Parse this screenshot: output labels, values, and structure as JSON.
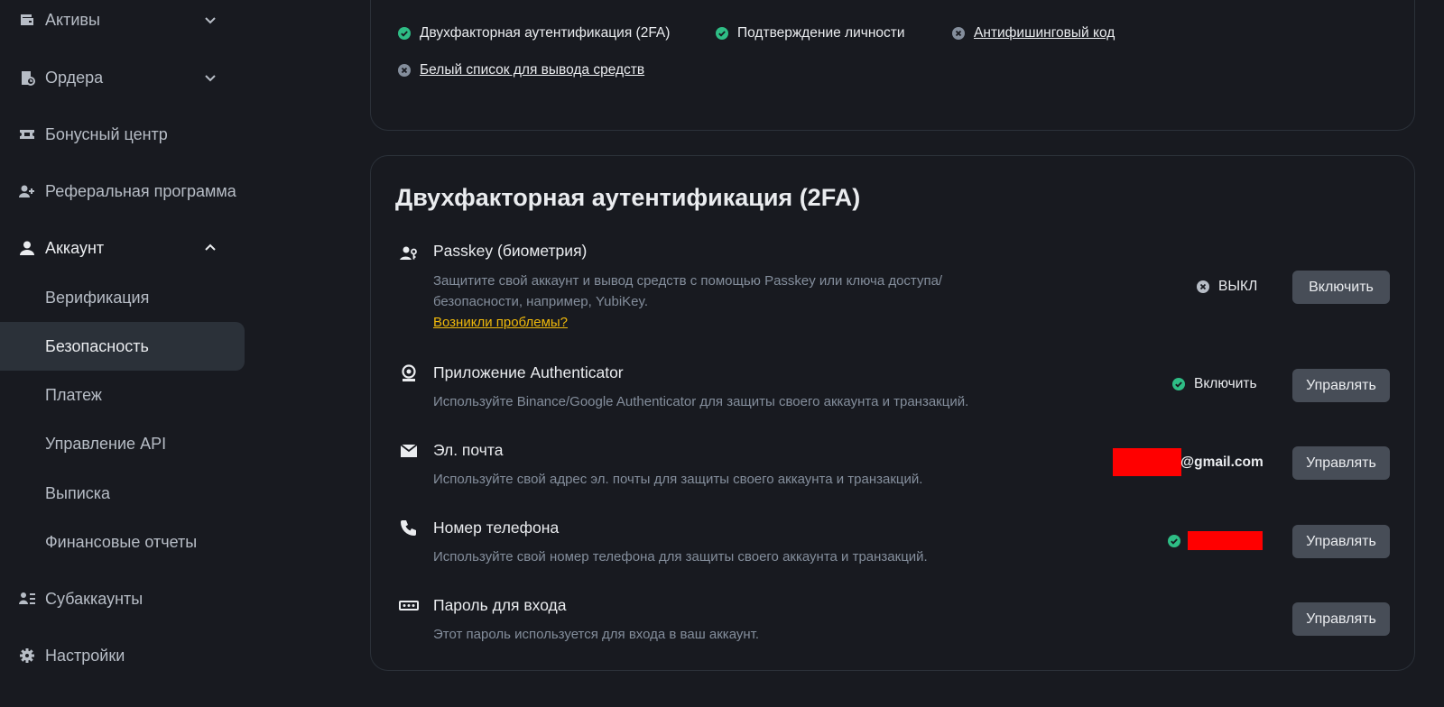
{
  "sidebar": {
    "assets": "Активы",
    "orders": "Ордера",
    "bonus_center": "Бонусный центр",
    "referral": "Реферальная программа",
    "account": "Аккаунт",
    "account_sub": [
      "Верификация",
      "Безопасность",
      "Платеж",
      "Управление API",
      "Выписка",
      "Финансовые отчеты"
    ],
    "subaccounts": "Субаккаунты",
    "settings": "Настройки"
  },
  "security_overview": {
    "items": [
      {
        "label": "Двухфакторная аутентификация (2FA)",
        "status": "on"
      },
      {
        "label": "Подтверждение личности",
        "status": "on"
      },
      {
        "label": "Антифишинговый код",
        "status": "off"
      },
      {
        "label": "Белый список для вывода средств",
        "status": "off"
      }
    ]
  },
  "twofa": {
    "title": "Двухфакторная аутентификация (2FA)",
    "rows": [
      {
        "icon": "passkey-icon",
        "title": "Passkey (биометрия)",
        "desc_line1": "Защитите свой аккаунт и вывод средств с помощью Passkey или ключа доступа/",
        "desc_line2": "безопасности, например, YubiKey.",
        "link": "Возникли проблемы?",
        "status": "ВЫКЛ",
        "button": "Включить"
      },
      {
        "icon": "authenticator-icon",
        "title": "Приложение Authenticator",
        "desc": "Используйте Binance/Google Authenticator для защиты своего аккаунта и транзакций.",
        "status": "Включить",
        "button": "Управлять"
      },
      {
        "icon": "mail-icon",
        "title": "Эл. почта",
        "desc": "Используйте свой адрес эл. почты для защиты своего аккаунта и транзакций.",
        "status": "@gmail.com",
        "button": "Управлять"
      },
      {
        "icon": "phone-icon",
        "title": "Номер телефона",
        "desc": "Используйте свой номер телефона для защиты своего аккаунта и транзакций.",
        "button": "Управлять"
      },
      {
        "icon": "password-icon",
        "title": "Пароль для входа",
        "desc": "Этот пароль используется для входа в ваш аккаунт.",
        "button": "Управлять"
      }
    ]
  },
  "colors": {
    "background": "#181a20",
    "success": "#2ebd85",
    "off": "#848e9c",
    "link": "#f0b90b",
    "button": "#474d57",
    "redaction": "#ff0000"
  }
}
